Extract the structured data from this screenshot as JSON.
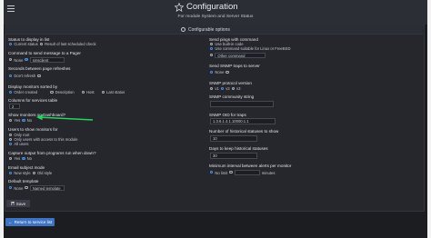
{
  "header": {
    "title": "Configuration",
    "subtitle": "For module System and Server Status"
  },
  "panel": {
    "title": "Configurable options"
  },
  "left": {
    "status_display": {
      "label": "Status to display in list",
      "options": [
        "Current status",
        "Result of last scheduled check"
      ],
      "selected": 0
    },
    "send_message": {
      "label": "Command to send message to a Pager",
      "options": [
        "None"
      ],
      "value": "smsclient"
    },
    "refresh": {
      "label": "Seconds between page refreshes",
      "options": [
        "Don't refresh"
      ]
    },
    "sort": {
      "label": "Display monitors sorted by",
      "options": [
        "Order created",
        "Description",
        "Host",
        "Last status"
      ],
      "selected": 0
    },
    "columns": {
      "label": "Columns for services table",
      "value": "2"
    },
    "show_monitors": {
      "label": "Show monitors on Dashboard?",
      "options": [
        "Yes",
        "No"
      ],
      "selected": 1
    },
    "users_show": {
      "label": "Users to show monitors for",
      "options": [
        "Only root",
        "Only users with access to this module",
        "All users"
      ],
      "selected": 2
    },
    "capture": {
      "label": "Capture output from programs run when down?",
      "options": [
        "Yes",
        "No"
      ],
      "selected": 1
    },
    "email_mode": {
      "label": "Email subject mode",
      "options": [
        "New style",
        "Old style"
      ],
      "selected": 0
    },
    "template": {
      "label": "Default template",
      "options": [
        "None",
        "Named template"
      ],
      "selected": 0
    }
  },
  "right": {
    "send_pings": {
      "label": "Send pings with command",
      "options": [
        "Use built-in code",
        "Use command suitable for Linux or FreeBSD",
        "Other command"
      ],
      "selected": 1
    },
    "snmp_traps": {
      "label": "Send SNMP traps to server",
      "options": [
        "None"
      ],
      "selected": 0
    },
    "snmp_version": {
      "label": "SNMP protocol version",
      "options": [
        "v1",
        "v2",
        "v3"
      ],
      "selected": 1
    },
    "snmp_community": {
      "label": "SNMP community string",
      "value": ""
    },
    "snmp_oid": {
      "label": "SNMP OID for traps",
      "value": "1.3.6.1.4.1.10000.1.1"
    },
    "hist_show": {
      "label": "Number of historical statuses to show",
      "value": "10"
    },
    "hist_keep": {
      "label": "Days to keep historical statuses",
      "value": "30"
    },
    "min_interval": {
      "label": "Minimum interval between alerts per monitor",
      "options": [
        "No limit"
      ],
      "unit": "minutes"
    }
  },
  "buttons": {
    "save": "Save",
    "return": "Return to service list"
  },
  "colors": {
    "accent": "#4a8fe7",
    "annotation_arrow": "#27d35a",
    "return_button": "#3f74c4"
  },
  "icons": [
    "menu-icon",
    "star-icon",
    "gear-icon",
    "save-icon",
    "arrow-left-icon"
  ]
}
